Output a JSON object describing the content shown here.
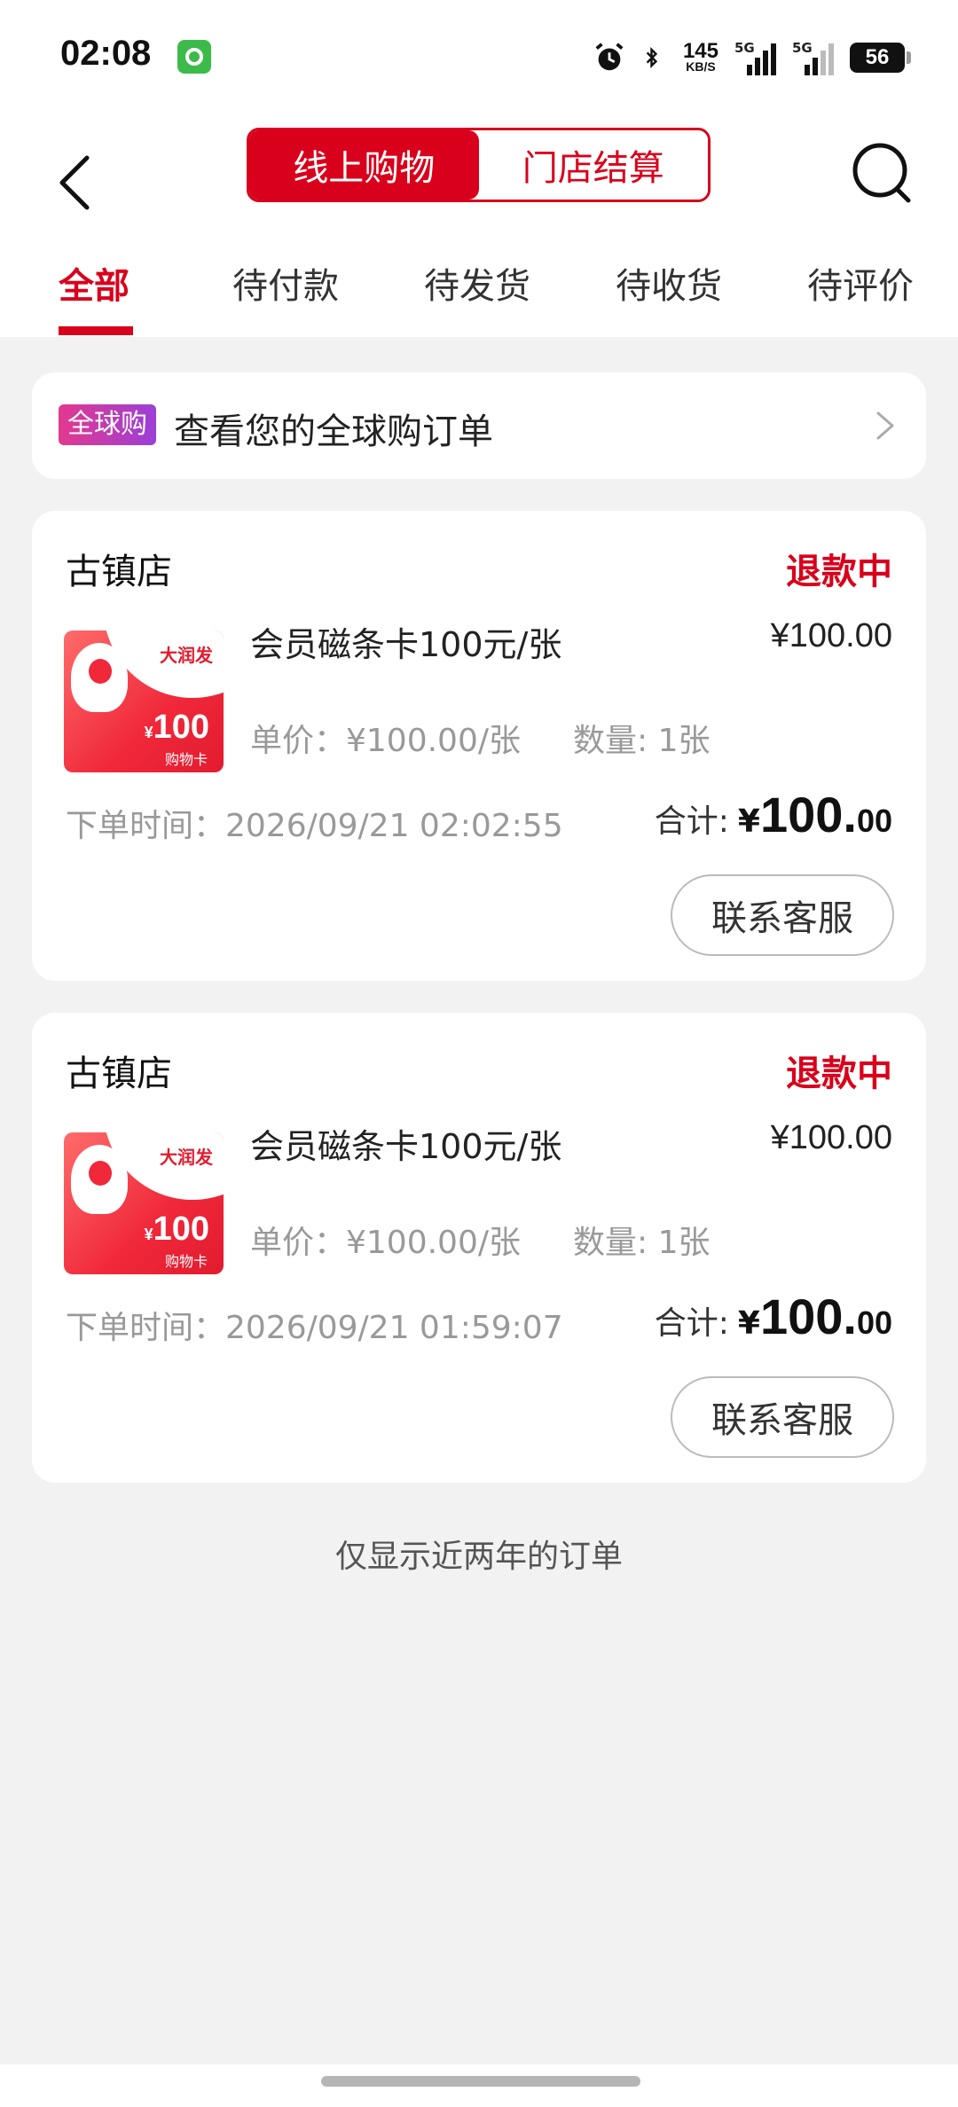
{
  "status_bar": {
    "time": "02:08",
    "net_speed": "145",
    "net_unit": "KB/S",
    "signal1_label": "5G",
    "signal2_label": "5G",
    "battery": "56"
  },
  "header": {
    "segments": [
      "线上购物",
      "门店结算"
    ],
    "tabs": [
      "全部",
      "待付款",
      "待发货",
      "待收货",
      "待评价"
    ]
  },
  "global_banner": {
    "badge": "全球购",
    "text": "查看您的全球购订单"
  },
  "orders": [
    {
      "store": "古镇店",
      "status": "退款中",
      "product_name": "会员磁条卡100元/张",
      "price": "¥100.00",
      "unit_price": "单价：¥100.00/张",
      "quantity": "数量: 1张",
      "order_time": "下单时间：2026/09/21 02:02:55",
      "total_label": "合计:",
      "total_currency": "¥",
      "total_int": "100.",
      "total_dec": "00",
      "button": "联系客服",
      "thumb": {
        "brand": "大润发",
        "amount": "100",
        "currency": "¥",
        "card_name": "购物卡"
      }
    },
    {
      "store": "古镇店",
      "status": "退款中",
      "product_name": "会员磁条卡100元/张",
      "price": "¥100.00",
      "unit_price": "单价：¥100.00/张",
      "quantity": "数量: 1张",
      "order_time": "下单时间：2026/09/21 01:59:07",
      "total_label": "合计:",
      "total_currency": "¥",
      "total_int": "100.",
      "total_dec": "00",
      "button": "联系客服",
      "thumb": {
        "brand": "大润发",
        "amount": "100",
        "currency": "¥",
        "card_name": "购物卡"
      }
    }
  ],
  "footnote": "仅显示近两年的订单",
  "colors": {
    "accent": "#d9001b",
    "background": "#f2f2f2"
  }
}
